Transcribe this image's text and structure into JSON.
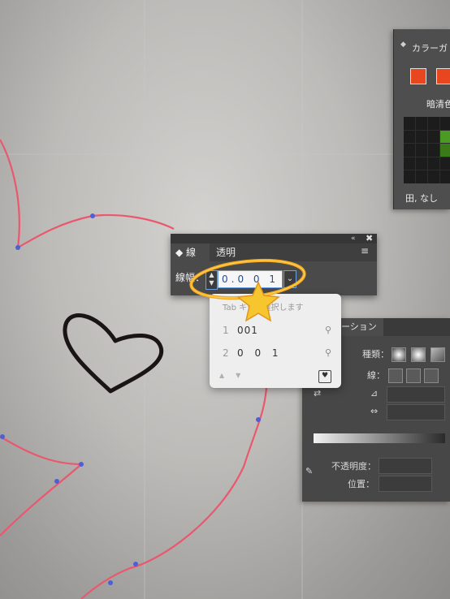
{
  "color_panel": {
    "title": "カラーガ",
    "subtitle": "暗清色",
    "none_label": "なし",
    "swatch_colors": [
      "#e8461e",
      "#e8461e"
    ]
  },
  "stroke_panel": {
    "tab_stroke": "線",
    "tab_transparency": "透明",
    "collapse_icon": "«",
    "close_icon": "✖",
    "menu_icon": "≡",
    "weight_label": "線幅：",
    "weight_value": "0.0 0 1",
    "dropdown_icon": "⌄"
  },
  "ime_popup": {
    "hint": "Tab キーで選択します",
    "candidates": [
      {
        "index": "1",
        "text": "001"
      },
      {
        "index": "2",
        "text": "0 0 1"
      }
    ],
    "search_icon": "search-icon"
  },
  "gradient_panel": {
    "tab_label": "ーション",
    "type_label": "種類：",
    "stroke_label": "線：",
    "opacity_label": "不透明度：",
    "position_label": "位置："
  },
  "colors": {
    "path_pink": "#e9586f",
    "anchor_blue": "#4d5fd6",
    "highlight_orange": "#f5a81f",
    "panel_bg": "#4a4a4a"
  }
}
